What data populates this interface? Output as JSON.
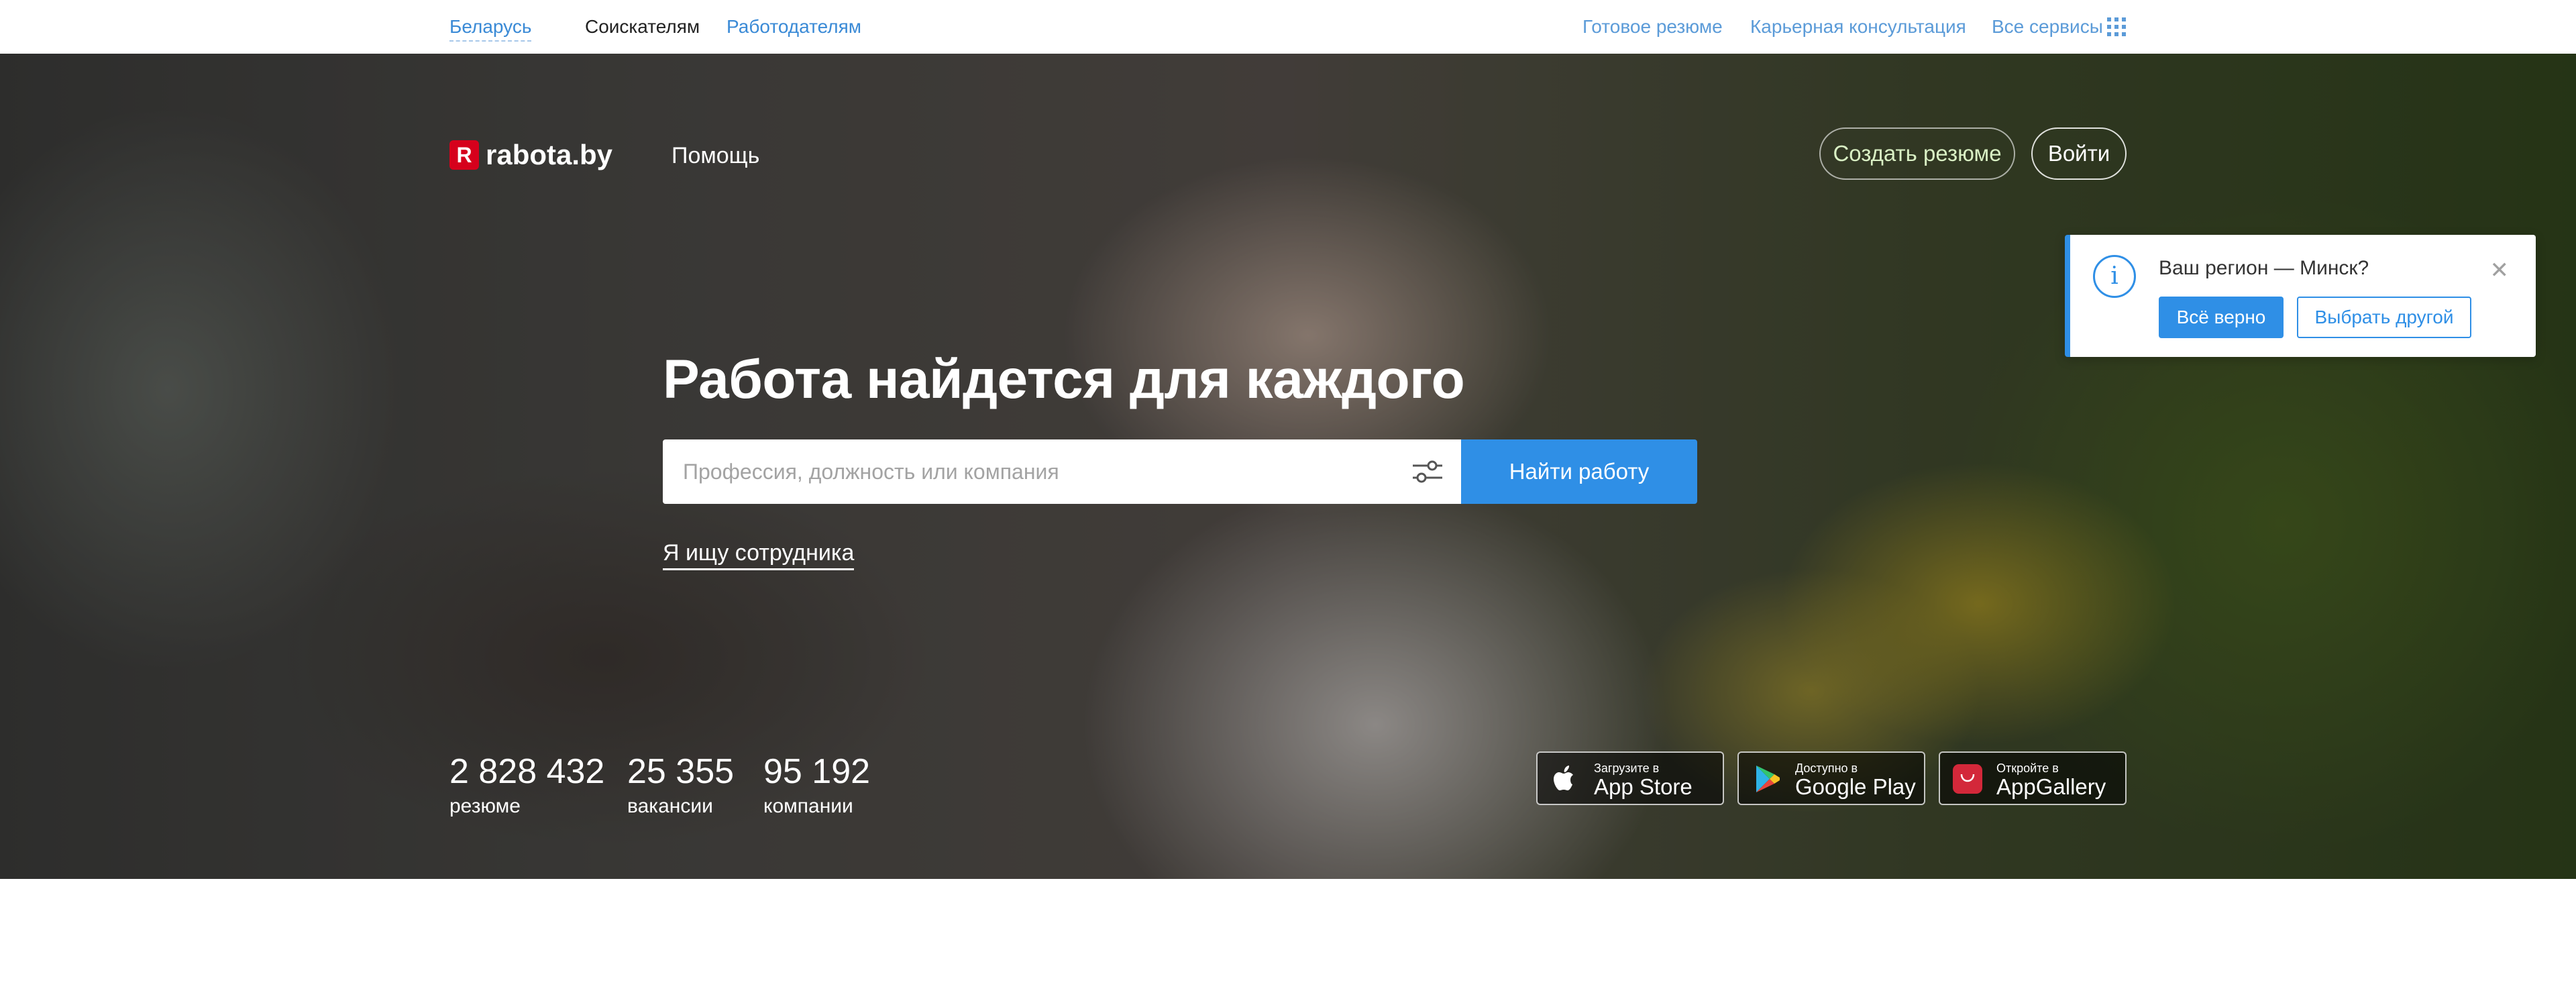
{
  "supernav": {
    "country": "Беларусь",
    "seekers": "Соискателям",
    "employers": "Работодателям",
    "ready_resume": "Готовое резюме",
    "career_consult": "Карьерная консультация",
    "all_services": "Все сервисы",
    "all_services_icon": "grid-icon"
  },
  "header": {
    "logo_mark": "R",
    "logo_text": "rabota.by",
    "help": "Помощь",
    "create_resume": "Создать резюме",
    "login": "Войти"
  },
  "hero": {
    "title": "Работа найдется для каждого",
    "search_placeholder": "Профессия, должность или компания",
    "search_value": "",
    "filter_icon": "sliders-icon",
    "search_button": "Найти работу",
    "employer_link": "Я ищу сотрудника"
  },
  "stats": [
    {
      "value": "2 828 432",
      "label": "резюме"
    },
    {
      "value": "25 355",
      "label": "вакансии"
    },
    {
      "value": "95 192",
      "label": "компании"
    }
  ],
  "app_stores": [
    {
      "small": "Загрузите в",
      "big": "App Store",
      "icon": "apple-icon"
    },
    {
      "small": "Доступно в",
      "big": "Google Play",
      "icon": "google-play-icon"
    },
    {
      "small": "Откройте в",
      "big": "AppGallery",
      "icon": "huawei-appgallery-icon"
    }
  ],
  "region_popup": {
    "question": "Ваш регион — Минск?",
    "confirm": "Всё верно",
    "choose_other": "Выбрать другой",
    "icon": "info-icon",
    "close": "✕"
  },
  "colors": {
    "accent": "#2f8fe6",
    "link": "#3a8ad6",
    "brand_red": "#d6001c"
  }
}
